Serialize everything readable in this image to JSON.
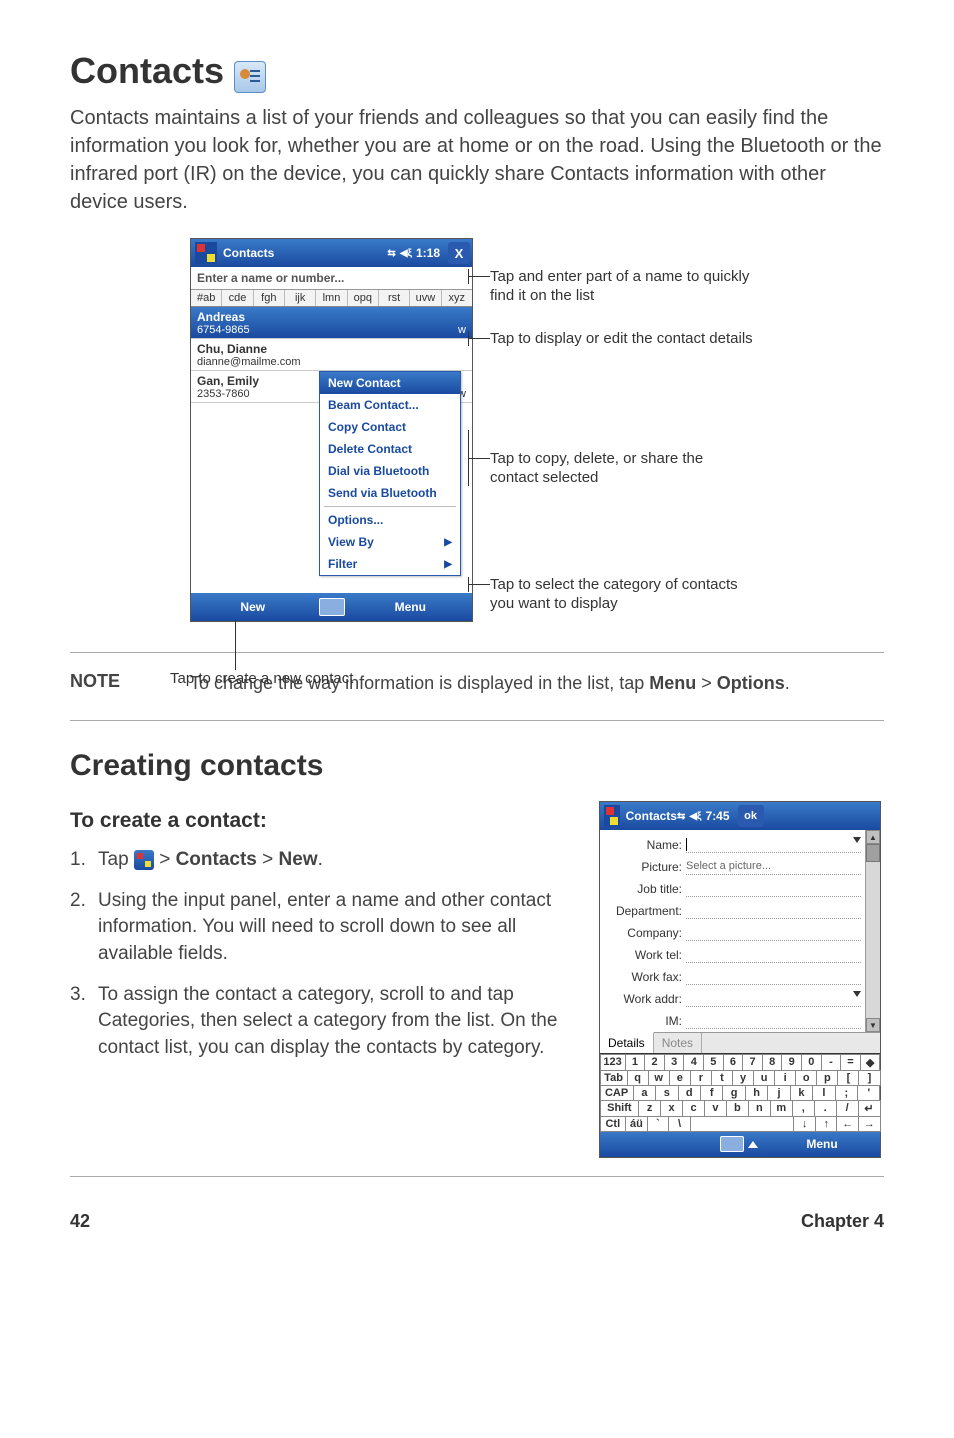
{
  "headings": {
    "h1": "Contacts",
    "h2": "Creating contacts",
    "h3": "To create a contact:"
  },
  "intro": "Contacts maintains a list of your friends and colleagues so that you can easily find the information you look for, whether you are at home or on the road. Using the Bluetooth or the infrared port (IR) on the device, you can quickly share Contacts information with other device users.",
  "screenshot1": {
    "title": "Contacts",
    "time": "1:18",
    "close": "X",
    "search_placeholder": "Enter a name or number...",
    "alpha": [
      "#ab",
      "cde",
      "fgh",
      "ijk",
      "lmn",
      "opq",
      "rst",
      "uvw",
      "xyz"
    ],
    "contacts": [
      {
        "name": "Andreas",
        "detail": "6754-9865",
        "tag": "w",
        "selected": true
      },
      {
        "name": "Chu, Dianne",
        "detail": "dianne@mailme.com",
        "tag": ""
      },
      {
        "name": "Gan, Emily",
        "detail": "2353-7860",
        "tag": "w"
      }
    ],
    "context_menu": {
      "header": "New Contact",
      "items": [
        "Beam Contact...",
        "Copy Contact",
        "Delete Contact",
        "Dial via Bluetooth",
        "Send via Bluetooth"
      ],
      "after_sep": [
        "Options...",
        "View By",
        "Filter"
      ]
    },
    "soft_left": "New",
    "soft_right": "Menu"
  },
  "annotations": {
    "a1": "Tap and enter part of a name to quickly find it on the list",
    "a2": "Tap to display or edit the contact details",
    "a3": "Tap to copy, delete, or share the contact selected",
    "a4": "Tap to select the category of contacts you want to display",
    "a5": "Tap to create a new contact"
  },
  "note": {
    "label": "NOTE",
    "text_pre": "To change the way information is displayed in the list, tap ",
    "menu": "Menu",
    "sep": " > ",
    "options": "Options",
    "dot": "."
  },
  "steps": {
    "s1a": "Tap ",
    "s1b": " > ",
    "s1c": "Contacts",
    "s1d": " > ",
    "s1e": "New",
    "s1f": ".",
    "s2": "Using the input panel, enter a name and other contact information. You will need to scroll down to see all available fields.",
    "s3": "To assign the contact a category, scroll to and tap Categories, then select a category from the list. On the contact list, you can display the contacts by category."
  },
  "screenshot2": {
    "title": "Contacts",
    "time": "7:45",
    "ok": "ok",
    "fields": [
      {
        "label": "Name:",
        "value": "",
        "cursor": true,
        "dropdown": true
      },
      {
        "label": "Picture:",
        "value": "Select a picture..."
      },
      {
        "label": "Job title:",
        "value": ""
      },
      {
        "label": "Department:",
        "value": ""
      },
      {
        "label": "Company:",
        "value": ""
      },
      {
        "label": "Work tel:",
        "value": ""
      },
      {
        "label": "Work fax:",
        "value": ""
      },
      {
        "label": "Work addr:",
        "value": "",
        "dropdown": true
      },
      {
        "label": "IM:",
        "value": ""
      }
    ],
    "tabs": [
      "Details",
      "Notes"
    ],
    "kbd": [
      [
        "123",
        "1",
        "2",
        "3",
        "4",
        "5",
        "6",
        "7",
        "8",
        "9",
        "0",
        "-",
        "=",
        "◆"
      ],
      [
        "Tab",
        "q",
        "w",
        "e",
        "r",
        "t",
        "y",
        "u",
        "i",
        "o",
        "p",
        "[",
        "]"
      ],
      [
        "CAP",
        "a",
        "s",
        "d",
        "f",
        "g",
        "h",
        "j",
        "k",
        "l",
        ";",
        "'"
      ],
      [
        "Shift",
        "z",
        "x",
        "c",
        "v",
        "b",
        "n",
        "m",
        ",",
        ".",
        "/",
        "↵"
      ],
      [
        "Ctl",
        "áü",
        "`",
        "\\",
        "",
        "↓",
        "↑",
        "←",
        "→"
      ]
    ],
    "soft_right": "Menu"
  },
  "footer": {
    "page": "42",
    "chapter": "Chapter 4"
  }
}
